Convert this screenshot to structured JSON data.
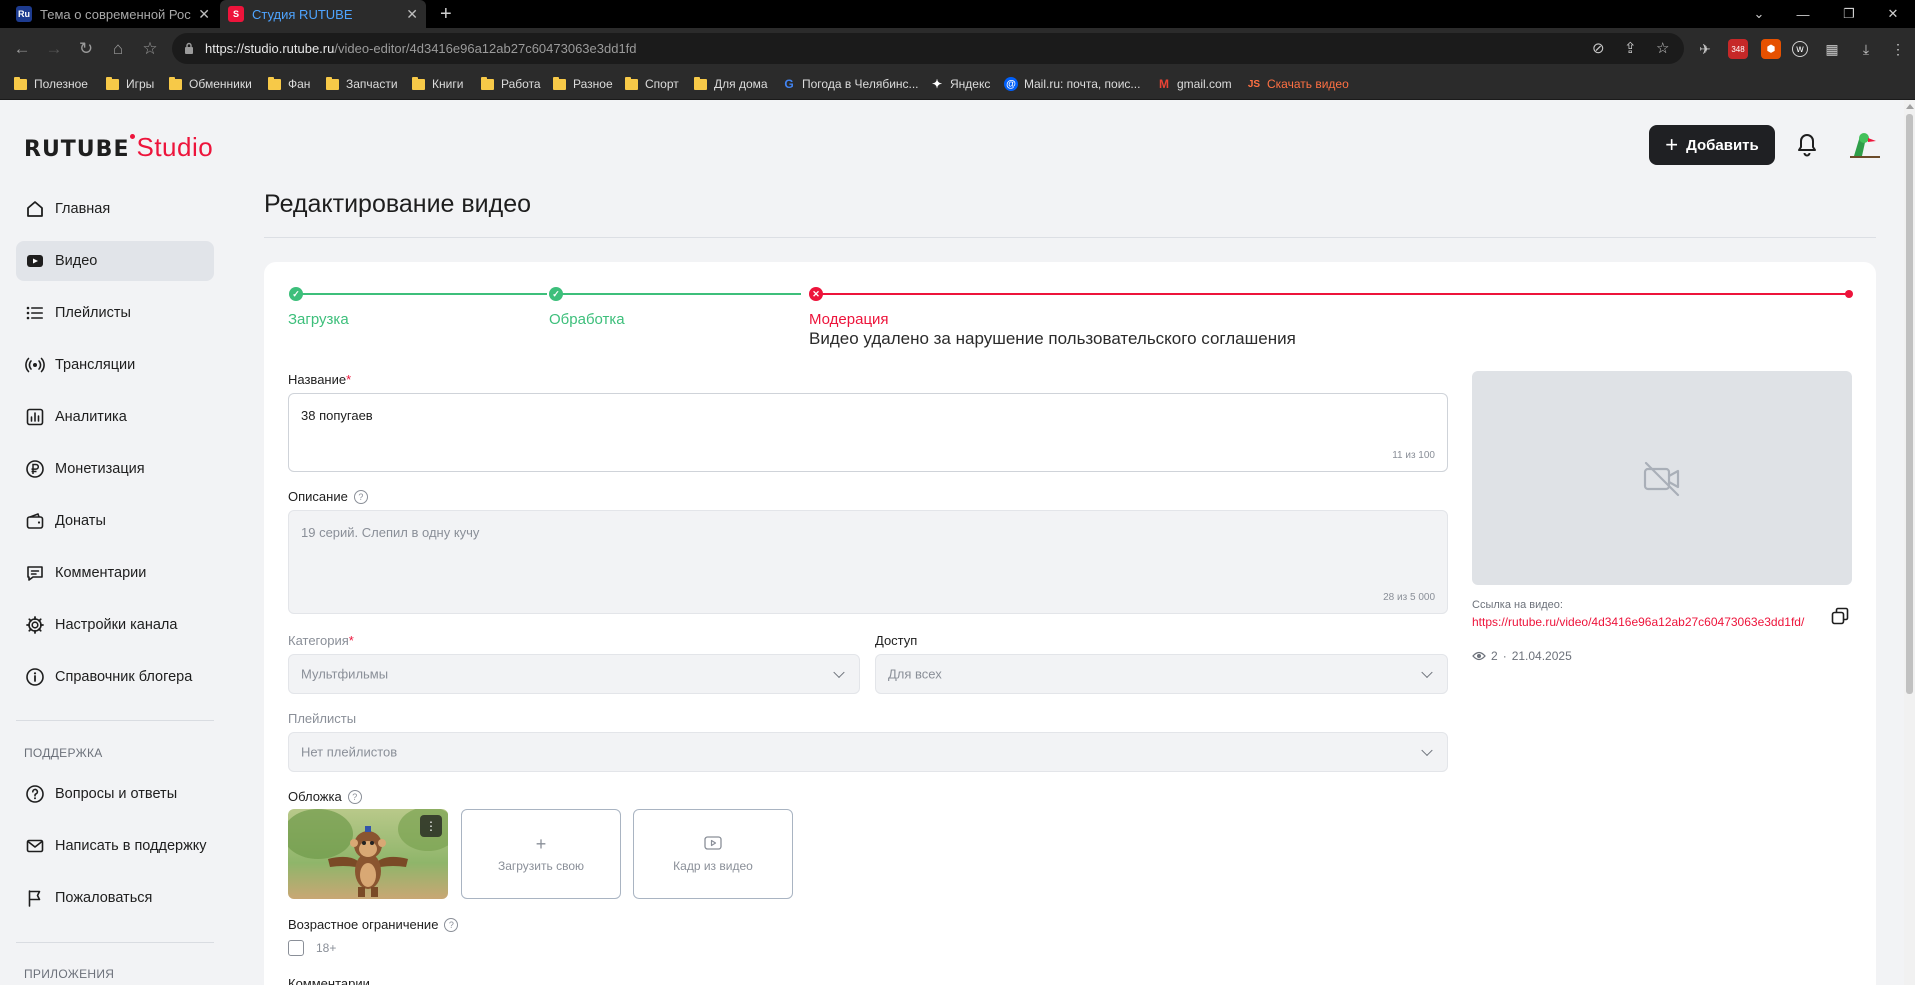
{
  "browser": {
    "tabs": [
      {
        "title": "Тема о современной Рос",
        "favicon": "Ru",
        "active": false
      },
      {
        "title": "Студия RUTUBE",
        "favicon": "S",
        "active": true
      }
    ],
    "url_host": "https://studio.rutube.ru",
    "url_path": "/video-editor/4d3416e96a12ab27c60473063e3dd1fd",
    "ext_badge": "348",
    "bookmarks": [
      {
        "label": "Полезное",
        "type": "folder"
      },
      {
        "label": "Игры",
        "type": "folder"
      },
      {
        "label": "Обменники",
        "type": "folder"
      },
      {
        "label": "Фан",
        "type": "folder"
      },
      {
        "label": "Запчасти",
        "type": "folder"
      },
      {
        "label": "Книги",
        "type": "folder"
      },
      {
        "label": "Работа",
        "type": "folder"
      },
      {
        "label": "Разное",
        "type": "folder"
      },
      {
        "label": "Спорт",
        "type": "folder"
      },
      {
        "label": "Для дома",
        "type": "folder"
      },
      {
        "label": "Погода в Челябинс...",
        "type": "google"
      },
      {
        "label": "Яндекс",
        "type": "yandex"
      },
      {
        "label": "Mail.ru: почта, поис...",
        "type": "mail"
      },
      {
        "label": "gmail.com",
        "type": "gmail"
      },
      {
        "label": "Скачать видео",
        "type": "js"
      }
    ]
  },
  "header": {
    "logo_main": "RUTUBE",
    "logo_accent": "Studio",
    "add_label": "Добавить"
  },
  "sidebar": {
    "items": [
      {
        "label": "Главная",
        "icon": "home-icon"
      },
      {
        "label": "Видео",
        "icon": "video-icon"
      },
      {
        "label": "Плейлисты",
        "icon": "playlist-icon"
      },
      {
        "label": "Трансляции",
        "icon": "broadcast-icon"
      },
      {
        "label": "Аналитика",
        "icon": "analytics-icon"
      },
      {
        "label": "Монетизация",
        "icon": "ruble-icon"
      },
      {
        "label": "Донаты",
        "icon": "wallet-icon"
      },
      {
        "label": "Комментарии",
        "icon": "comment-icon"
      },
      {
        "label": "Настройки канала",
        "icon": "gear-icon"
      },
      {
        "label": "Справочник блогера",
        "icon": "info-icon"
      }
    ],
    "support_title": "ПОДДЕРЖКА",
    "support_items": [
      {
        "label": "Вопросы и ответы",
        "icon": "question-icon"
      },
      {
        "label": "Написать в поддержку",
        "icon": "mail-icon"
      },
      {
        "label": "Пожаловаться",
        "icon": "flag-icon"
      }
    ],
    "apps_title": "ПРИЛОЖЕНИЯ"
  },
  "main": {
    "title": "Редактирование видео",
    "steps": [
      {
        "label": "Загрузка",
        "status": "done"
      },
      {
        "label": "Обработка",
        "status": "done"
      },
      {
        "label": "Модерация",
        "status": "error"
      }
    ],
    "moderation_message": "Видео удалено за нарушение пользовательского соглашения",
    "name_label": "Название",
    "name_value": "38 попугаев",
    "name_counter": "11 из 100",
    "description_label": "Описание",
    "description_value": "19 серий. Слепил в одну кучу",
    "description_counter": "28 из 5 000",
    "category_label": "Категория",
    "category_value": "Мультфильмы",
    "access_label": "Доступ",
    "access_value": "Для всех",
    "playlists_label": "Плейлисты",
    "playlists_value": "Нет плейлистов",
    "cover_label": "Обложка",
    "cover_upload": "Загрузить свою",
    "cover_frame": "Кадр из видео",
    "age_label": "Возрастное ограничение",
    "age_option": "18+",
    "age_checked": false,
    "comments_label": "Комментарии"
  },
  "preview": {
    "link_label": "Ссылка на видео:",
    "link": "https://rutube.ru/video/4d3416e96a12ab27c60473063e3dd1fd/",
    "views": "2",
    "date": "21.04.2025"
  },
  "colors": {
    "accent": "#ed143b",
    "success": "#3dbf7b",
    "dark_button": "#1f2023"
  }
}
